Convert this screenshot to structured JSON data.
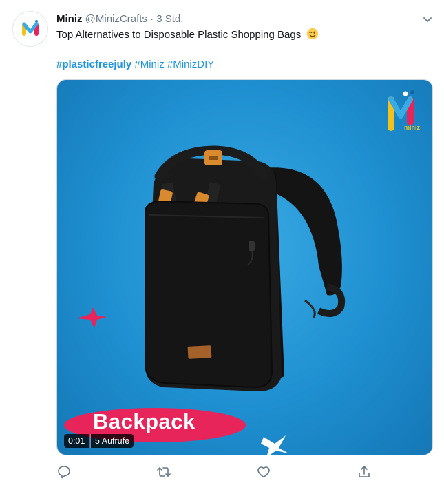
{
  "tweet": {
    "name": "Miniz",
    "handle": "@MinizCrafts",
    "separator": "·",
    "time": "3 Std.",
    "text": "Top Alternatives to Disposable Plastic Shopping Bags",
    "emoji": "winking-face",
    "hashtags": [
      "#plasticfreejuly",
      "#Miniz",
      "#MinizDIY"
    ]
  },
  "media": {
    "overlay_label": "Backpack",
    "video_time": "0:01",
    "video_views": "5 Aufrufe",
    "logo_text": "miniz",
    "background_color": "#1e8fd0",
    "accent_color": "#e8255a"
  },
  "actions": {
    "reply_icon": "reply-icon",
    "retweet_icon": "retweet-icon",
    "like_icon": "heart-icon",
    "share_icon": "share-icon"
  }
}
